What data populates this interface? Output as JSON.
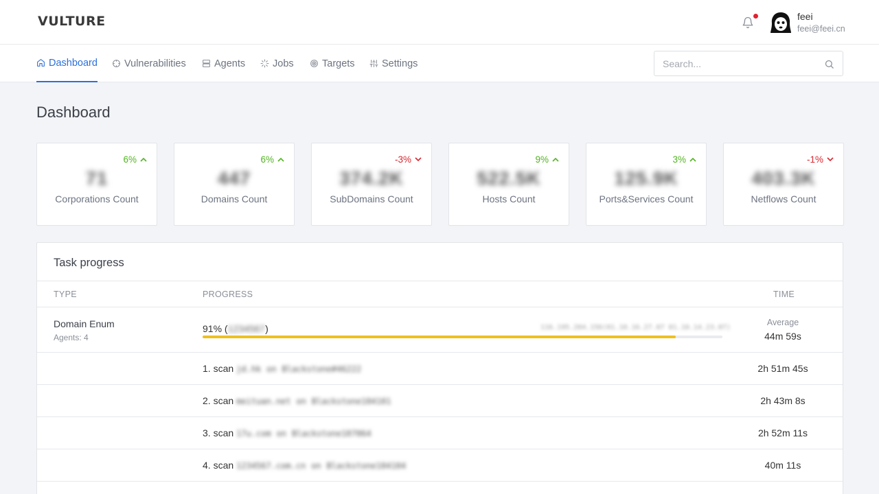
{
  "app": {
    "logo": "VULTURE"
  },
  "user": {
    "name": "feei",
    "email": "feei@feei.cn"
  },
  "nav": {
    "items": [
      {
        "label": "Dashboard",
        "icon": "home-icon"
      },
      {
        "label": "Vulnerabilities",
        "icon": "crosshair-icon"
      },
      {
        "label": "Agents",
        "icon": "server-icon"
      },
      {
        "label": "Jobs",
        "icon": "loader-icon"
      },
      {
        "label": "Targets",
        "icon": "target-icon"
      },
      {
        "label": "Settings",
        "icon": "sliders-icon"
      }
    ],
    "active": "Dashboard"
  },
  "search": {
    "placeholder": "Search..."
  },
  "page": {
    "title": "Dashboard"
  },
  "stats": [
    {
      "delta": "6%",
      "direction": "up",
      "value": "71",
      "label": "Corporations Count"
    },
    {
      "delta": "6%",
      "direction": "up",
      "value": "447",
      "label": "Domains Count"
    },
    {
      "delta": "-3%",
      "direction": "down",
      "value": "374.2K",
      "label": "SubDomains Count"
    },
    {
      "delta": "9%",
      "direction": "up",
      "value": "522.5K",
      "label": "Hosts Count"
    },
    {
      "delta": "3%",
      "direction": "up",
      "value": "125.9K",
      "label": "Ports&Services Count"
    },
    {
      "delta": "-1%",
      "direction": "down",
      "value": "403.3K",
      "label": "Netflows Count"
    }
  ],
  "colors": {
    "accent": "#2a6fdb",
    "up": "#52b421",
    "down": "#d9262f",
    "progress": "#efc01f"
  },
  "task_progress": {
    "title": "Task progress",
    "columns": {
      "type": "TYPE",
      "progress": "PROGRESS",
      "time": "TIME"
    },
    "task": {
      "type": "Domain Enum",
      "agents": "Agents: 4",
      "percent_label": "91%",
      "percent": 91,
      "count_blurred": "1234567",
      "detail_blurred": "116.195.204.156(01.10.16.27.07  01.10.14.23.07)",
      "avg_label": "Average",
      "avg_value": "44m 59s"
    },
    "scans": [
      {
        "label": "1. scan",
        "target": "jd.hk",
        "on": "on",
        "agent": "Blackstone#46222",
        "time": "2h 51m 45s"
      },
      {
        "label": "2. scan",
        "target": "meituan.net",
        "on": "on",
        "agent": "Blackstone104101",
        "time": "2h 43m 8s"
      },
      {
        "label": "3. scan",
        "target": "17u.com",
        "on": "on",
        "agent": "Blackstone107064",
        "time": "2h 52m 11s"
      },
      {
        "label": "4. scan",
        "target": "1234567.com.cn",
        "on": "on",
        "agent": "Blackstone104104",
        "time": "40m 11s"
      }
    ]
  }
}
